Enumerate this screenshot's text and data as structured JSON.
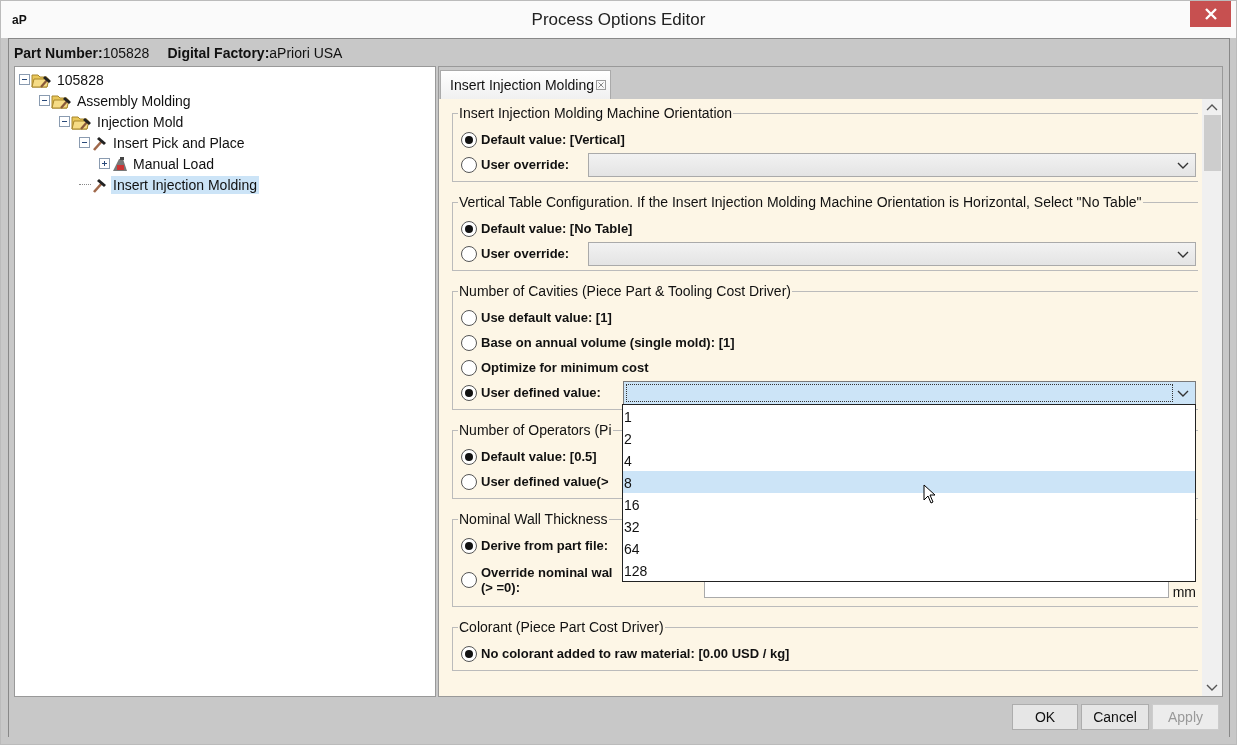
{
  "window": {
    "logo": "aP",
    "title": "Process Options Editor"
  },
  "header": {
    "part_number_label": "Part Number:",
    "part_number": "105828",
    "factory_label": "Digital Factory:",
    "factory": "aPriori USA"
  },
  "tree": [
    {
      "label": "105828",
      "kind": "folder",
      "expanded": true,
      "selected": false,
      "children": [
        {
          "label": "Assembly Molding",
          "kind": "folder",
          "expanded": true,
          "selected": false,
          "children": [
            {
              "label": "Injection Mold",
              "kind": "folder",
              "expanded": true,
              "selected": false,
              "children": [
                {
                  "label": "Insert Pick and Place",
                  "kind": "hammer",
                  "expanded": true,
                  "selected": false,
                  "children": [
                    {
                      "label": "Manual Load",
                      "kind": "machine",
                      "expanded": false,
                      "selected": false
                    }
                  ]
                },
                {
                  "label": "Insert Injection Molding",
                  "kind": "hammer",
                  "selected": true
                }
              ]
            }
          ]
        }
      ]
    }
  ],
  "tabs": [
    {
      "label": "Insert Injection Molding",
      "selected": true
    }
  ],
  "sections": [
    {
      "title": "Insert Injection Molding Machine Orientation",
      "options": [
        {
          "label": "Default value: [Vertical]",
          "selected": true,
          "kind": "plain"
        },
        {
          "label": "User override:",
          "selected": false,
          "kind": "combo",
          "open": false
        }
      ]
    },
    {
      "title": "Vertical Table Configuration. If the Insert Injection Molding Machine Orientation is Horizontal, Select \"No Table\"",
      "options": [
        {
          "label": "Default value: [No Table]",
          "selected": true,
          "kind": "plain"
        },
        {
          "label": "User override:",
          "selected": false,
          "kind": "combo",
          "open": false
        }
      ]
    },
    {
      "title": "Number of Cavities (Piece Part & Tooling Cost Driver)",
      "options": [
        {
          "label": "Use default value: [1]",
          "selected": false,
          "kind": "plain"
        },
        {
          "label": "Base on annual volume (single mold): [1]",
          "selected": false,
          "kind": "plain"
        },
        {
          "label": "Optimize for minimum cost",
          "selected": false,
          "kind": "plain"
        },
        {
          "label": "User defined value:",
          "selected": true,
          "kind": "combo",
          "open": true
        }
      ]
    },
    {
      "title": "Number of Operators (Pi",
      "options": [
        {
          "label": "Default value: [0.5]",
          "selected": true,
          "kind": "plain"
        },
        {
          "label": "User defined value(>",
          "selected": false,
          "kind": "plain"
        }
      ]
    },
    {
      "title": "Nominal Wall Thickness",
      "options": [
        {
          "label": "Derive from part file:",
          "selected": true,
          "kind": "plain"
        },
        {
          "label": "Override nominal wal",
          "label_2": "(> =0):",
          "selected": false,
          "kind": "input",
          "unit": "mm"
        }
      ]
    },
    {
      "title": "Colorant (Piece Part Cost Driver)",
      "options": [
        {
          "label": "No colorant added to raw material: [0.00 USD / kg]",
          "selected": true,
          "kind": "plain"
        }
      ]
    }
  ],
  "dropdown": {
    "items": [
      {
        "label": "1",
        "selected": false
      },
      {
        "label": "2",
        "selected": false
      },
      {
        "label": "4",
        "selected": false
      },
      {
        "label": "8",
        "selected": true
      },
      {
        "label": "16",
        "selected": false
      },
      {
        "label": "32",
        "selected": false
      },
      {
        "label": "64",
        "selected": false
      },
      {
        "label": "128",
        "selected": false
      }
    ]
  },
  "buttons": [
    {
      "label": "OK",
      "disabled": false
    },
    {
      "label": "Cancel",
      "disabled": false
    },
    {
      "label": "Apply",
      "disabled": true
    }
  ]
}
